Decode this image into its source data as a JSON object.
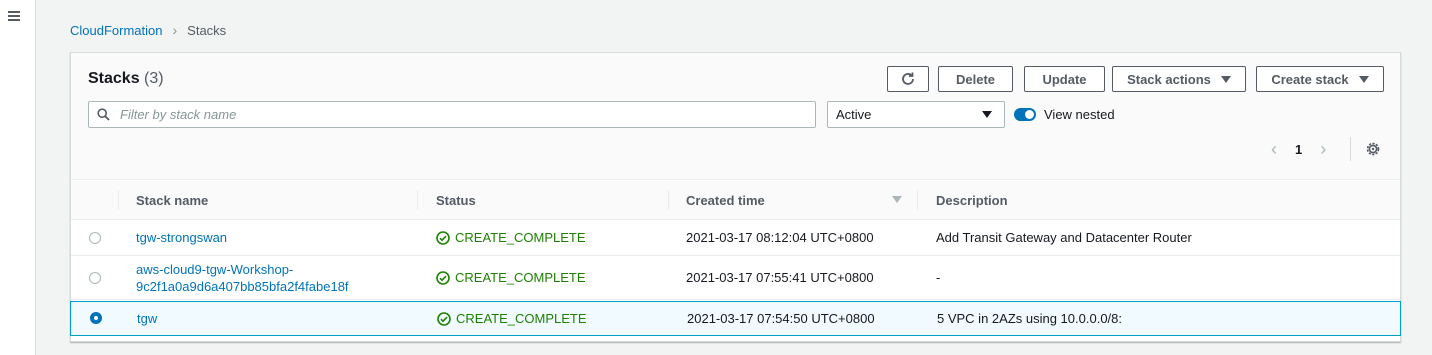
{
  "breadcrumb": {
    "root": "CloudFormation",
    "current": "Stacks"
  },
  "panel": {
    "title": "Stacks",
    "count": "(3)"
  },
  "toolbar": {
    "delete_label": "Delete",
    "update_label": "Update",
    "stack_actions_label": "Stack actions",
    "create_stack_label": "Create stack"
  },
  "filter": {
    "placeholder": "Filter by stack name",
    "value": ""
  },
  "status_filter": {
    "selected": "Active"
  },
  "view_nested": {
    "label": "View nested",
    "enabled": true
  },
  "pagination": {
    "current_page": "1"
  },
  "columns": [
    "Stack name",
    "Status",
    "Created time",
    "Description"
  ],
  "rows": [
    {
      "name_line1": "tgw-strongswan",
      "name_line2": "",
      "status": "CREATE_COMPLETE",
      "created": "2021-03-17 08:12:04 UTC+0800",
      "description": "Add Transit Gateway and Datacenter Router",
      "selected": false
    },
    {
      "name_line1": "aws-cloud9-tgw-Workshop-",
      "name_line2": "9c2f1a0a9d6a407bb85bfa2f4fabe18f",
      "status": "CREATE_COMPLETE",
      "created": "2021-03-17 07:55:41 UTC+0800",
      "description": "-",
      "selected": false
    },
    {
      "name_line1": "tgw",
      "name_line2": "",
      "status": "CREATE_COMPLETE",
      "created": "2021-03-17 07:54:50 UTC+0800",
      "description": "5 VPC in 2AZs using 10.0.0.0/8:",
      "selected": true
    }
  ],
  "colors": {
    "link": "#0073bb",
    "success": "#1d8102",
    "selected_border": "#00a1c9"
  }
}
